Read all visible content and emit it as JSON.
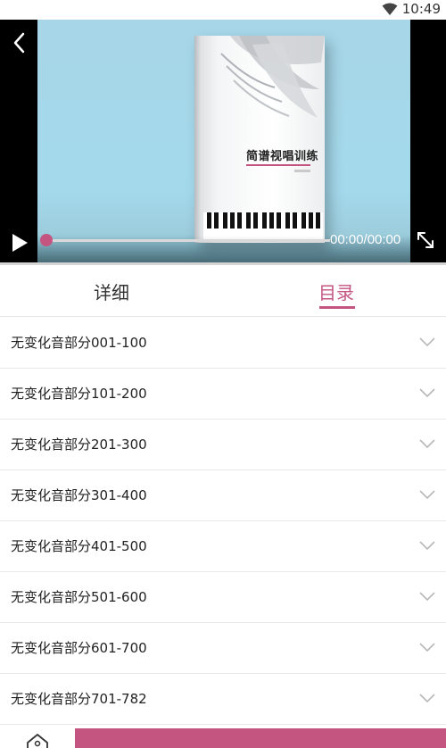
{
  "status_bar": {
    "time": "10:49",
    "icon": "wifi-icon"
  },
  "player": {
    "back_icon": "back-arrow-icon",
    "play_icon": "play-icon",
    "fullscreen_icon": "fullscreen-icon",
    "time_readout": "00:00/00:00",
    "progress": 0,
    "accent_color": "#c45581",
    "cover": {
      "title": "简谱视唱训练"
    }
  },
  "tabs": [
    {
      "label": "详细",
      "active": false
    },
    {
      "label": "目录",
      "active": true
    }
  ],
  "catalog": {
    "items": [
      {
        "label": "无变化音部分001-100"
      },
      {
        "label": "无变化音部分101-200"
      },
      {
        "label": "无变化音部分201-300"
      },
      {
        "label": "无变化音部分301-400"
      },
      {
        "label": "无变化音部分401-500"
      },
      {
        "label": "无变化音部分501-600"
      },
      {
        "label": "无变化音部分601-700"
      },
      {
        "label": "无变化音部分701-782"
      }
    ],
    "expand_icon": "chevron-down-icon"
  },
  "bottom_bar": {
    "home_icon": "home-icon",
    "accent_color": "#c45581"
  }
}
